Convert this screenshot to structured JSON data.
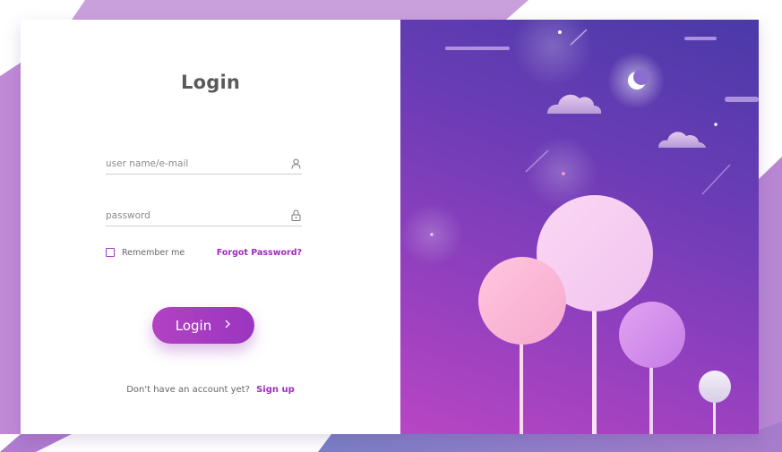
{
  "login": {
    "title": "Login",
    "username_placeholder": "user name/e-mail",
    "password_placeholder": "password",
    "remember_label": "Remember me",
    "forgot_label": "Forgot Password?",
    "button_label": "Login",
    "signup_prompt": "Don't have an account yet?",
    "signup_label": "Sign up"
  },
  "colors": {
    "accent": "#a12bbf",
    "panel_gradient_start": "#4a3aa8",
    "panel_gradient_end": "#b846c3"
  },
  "icons": {
    "username": "user-icon",
    "password": "lock-icon",
    "button": "chevron-right-icon",
    "moon": "moon-icon"
  }
}
